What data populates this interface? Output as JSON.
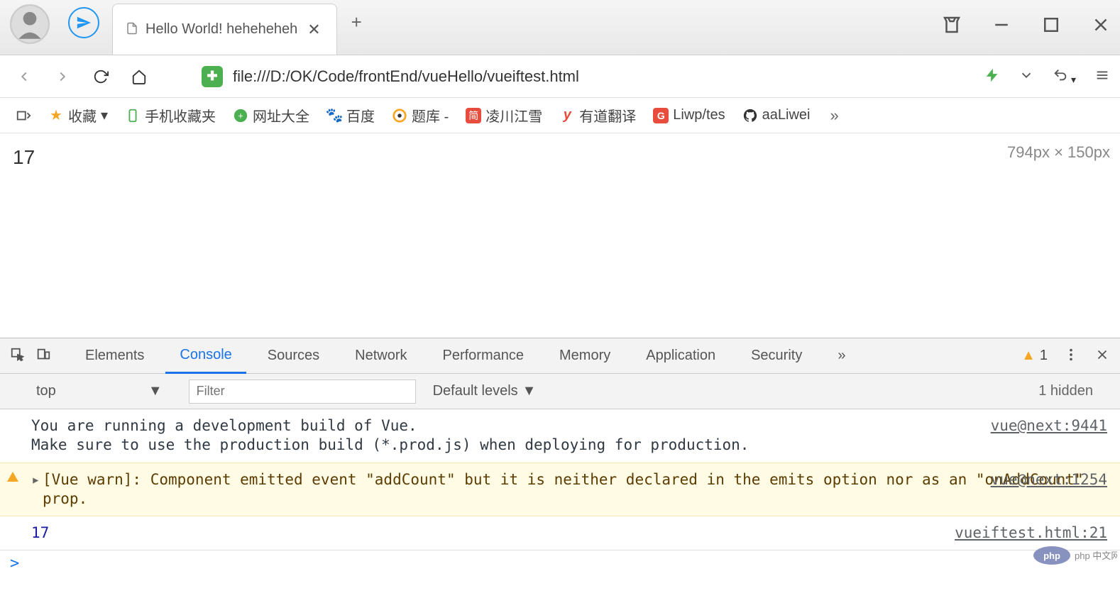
{
  "titlebar": {
    "tab_title": "Hello World! heheheheh",
    "close_glyph": "✕",
    "newtab_glyph": "+"
  },
  "address": {
    "url": "file:///D:/OK/Code/frontEnd/vueHello/vueiftest.html"
  },
  "bookmarks": {
    "fav": "收藏",
    "mobile": "手机收藏夹",
    "wzdh": "网址大全",
    "baidu": "百度",
    "tiku": "题库 -",
    "lcjx": "凌川江雪",
    "youdao": "有道翻译",
    "liwp": "Liwp/tes",
    "aaliwei": "aaLiwei",
    "more": "»"
  },
  "page": {
    "content": "17",
    "ruler": "794px × 150px"
  },
  "devtools": {
    "tabs": {
      "elements": "Elements",
      "console": "Console",
      "sources": "Sources",
      "network": "Network",
      "performance": "Performance",
      "memory": "Memory",
      "application": "Application",
      "security": "Security",
      "more": "»"
    },
    "warn_count": "1",
    "toolbar": {
      "context": "top",
      "filter_placeholder": "Filter",
      "levels": "Default levels",
      "hidden": "1 hidden"
    },
    "messages": {
      "dev_build": "You are running a development build of Vue.\nMake sure to use the production build (*.prod.js) when deploying for production.",
      "dev_build_src": "vue@next:9441",
      "warn": "[Vue warn]: Component emitted event \"addCount\" but it is neither declared in the emits option nor as an \"onAddCount\" prop.",
      "warn_src": "vue@next:1254",
      "log_val": "17",
      "log_src": "vueiftest.html:21",
      "prompt": ">"
    }
  },
  "watermark": "php 中文网"
}
